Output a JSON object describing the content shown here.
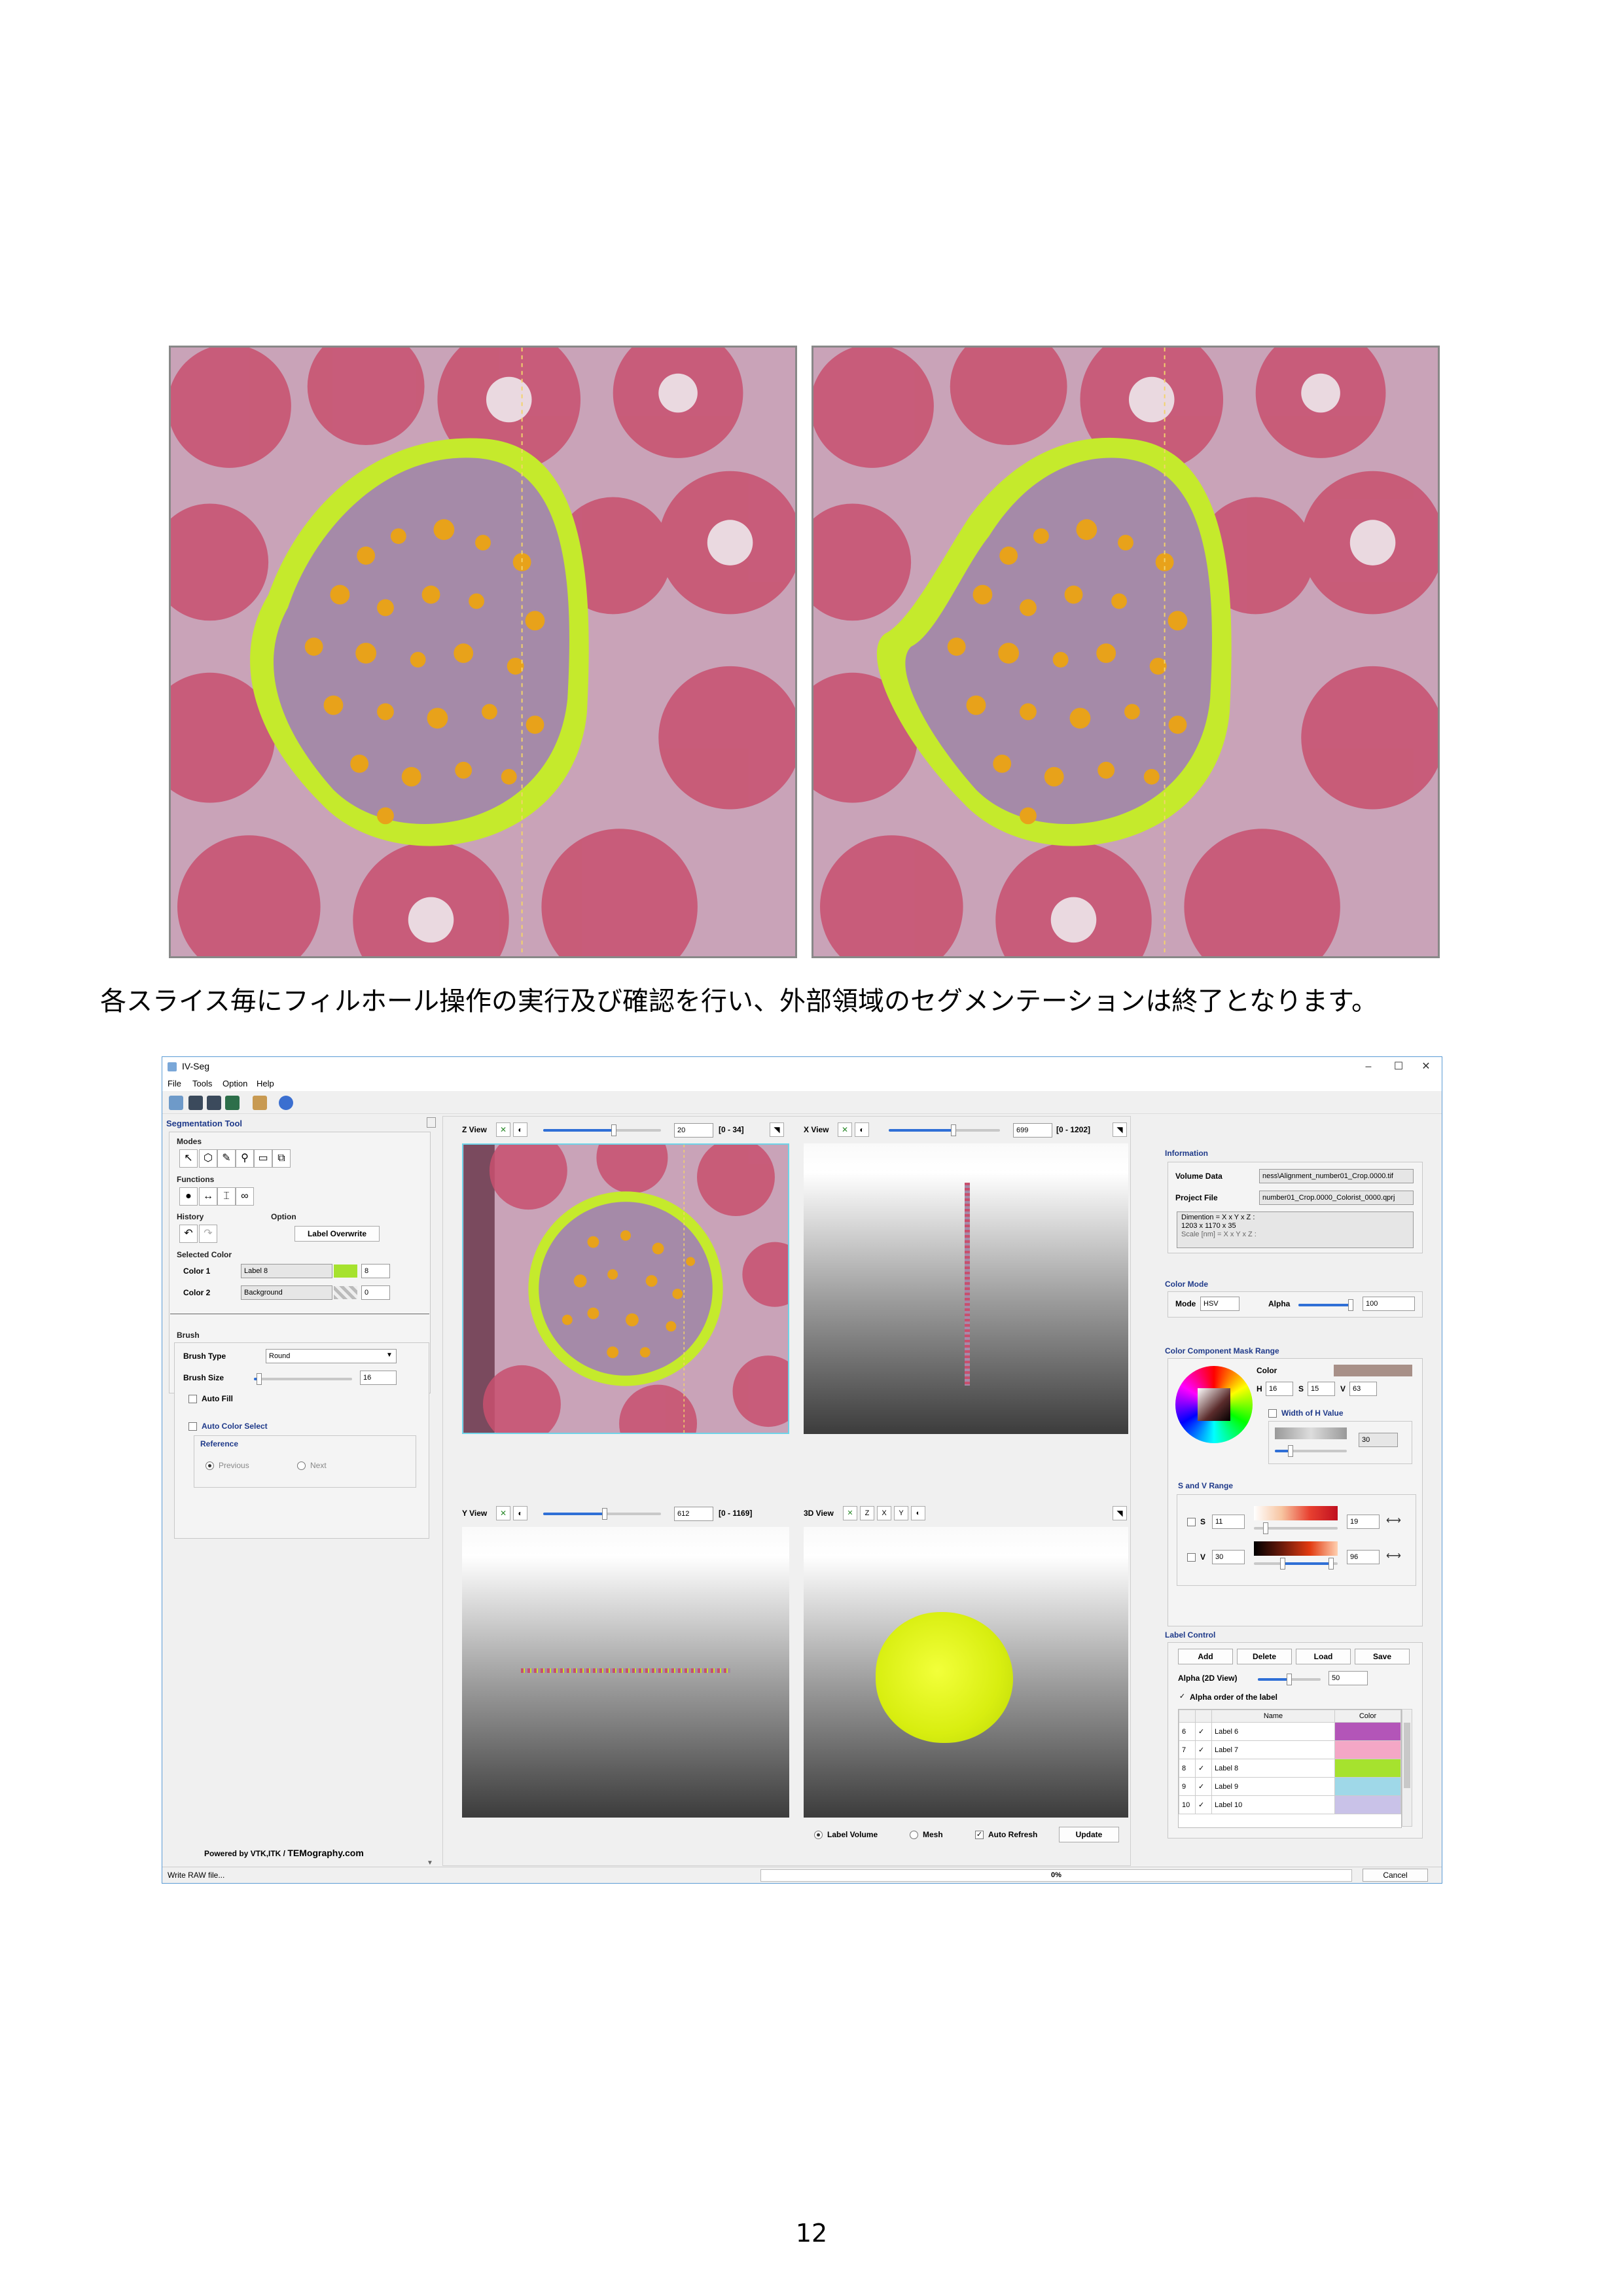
{
  "caption": "各スライス毎にフィルホール操作の実行及び確認を行い、外部領域のセグメンテーションは終了となります。",
  "page_number": "12",
  "window": {
    "title": "IV-Seg",
    "menu": [
      "File",
      "Tools",
      "Option",
      "Help"
    ],
    "controls": {
      "minimize": "–",
      "maximize": "☐",
      "close": "✕"
    }
  },
  "left_panel": {
    "title": "Segmentation Tool",
    "modes_label": "Modes",
    "functions_label": "Functions",
    "history_label": "History",
    "option_label": "Option",
    "label_overwrite": "Label Overwrite",
    "selected_color_label": "Selected Color",
    "color1_label": "Color 1",
    "color1_value": "Label 8",
    "color1_index": "8",
    "color1_swatch": "#a6e22e",
    "color2_label": "Color 2",
    "color2_value": "Background",
    "color2_index": "0",
    "brush_label": "Brush",
    "brush_type_label": "Brush Type",
    "brush_type_value": "Round",
    "brush_size_label": "Brush Size",
    "brush_size_value": "16",
    "brush_size_level": 0.05,
    "auto_fill": "Auto Fill",
    "auto_color_select": "Auto Color Select",
    "reference_label": "Reference",
    "previous": "Previous",
    "next": "Next",
    "powered_by": "Powered by VTK,ITK / ",
    "powered_brand": "TEMography.com"
  },
  "views": {
    "z": {
      "label": "Z View",
      "value": "20",
      "range": "[0 - 34]",
      "level": 0.6
    },
    "x": {
      "label": "X View",
      "value": "699",
      "range": "[0 - 1202]",
      "level": 0.58
    },
    "y": {
      "label": "Y View",
      "value": "612",
      "range": "[0 - 1169]",
      "level": 0.52
    },
    "d3": {
      "label": "3D View"
    },
    "label_volume": "Label Volume",
    "mesh": "Mesh",
    "auto_refresh": "Auto Refresh",
    "update": "Update"
  },
  "right_panel": {
    "information_label": "Information",
    "volume_data_label": "Volume Data",
    "volume_data_value": "ness\\Alignment_number01_Crop.0000.tif",
    "project_file_label": "Project File",
    "project_file_value": "number01_Crop.0000_Colorist_0000.qprj",
    "dimension_line1": "Dimention = X x Y x Z :",
    "dimension_line2": "1203 x 1170 x 35",
    "dimension_line3": "Scale [nm] = X x Y x Z :",
    "color_mode_label": "Color Mode",
    "mode_label": "Mode",
    "mode_value": "HSV",
    "alpha_label": "Alpha",
    "alpha_value": "100",
    "alpha_level": 1.0,
    "mask_range_label": "Color Component Mask Range",
    "color_label": "Color",
    "color_swatch": "#a89088",
    "h_label": "H",
    "h_value": "16",
    "s_label": "S",
    "s_value": "15",
    "v_label": "V",
    "v_value": "63",
    "width_h_label": "Width of H Value",
    "width_h_value": "30",
    "sv_range_label": "S and V Range",
    "s_min": "11",
    "s_max": "19",
    "v_min": "30",
    "v_max": "96",
    "label_control_label": "Label Control",
    "add": "Add",
    "delete": "Delete",
    "load": "Load",
    "save": "Save",
    "alpha2d_label": "Alpha (2D View)",
    "alpha2d_value": "50",
    "alpha2d_level": 0.5,
    "alpha_order_label": "Alpha order of the label",
    "table_name_header": "Name",
    "table_color_header": "Color",
    "labels": [
      {
        "index": "6",
        "name": "Label 6",
        "color": "#b355b8"
      },
      {
        "index": "7",
        "name": "Label 7",
        "color": "#f4a7c6"
      },
      {
        "index": "8",
        "name": "Label 8",
        "color": "#a6e22e"
      },
      {
        "index": "9",
        "name": "Label 9",
        "color": "#9fd8e8"
      },
      {
        "index": "10",
        "name": "Label 10",
        "color": "#c9c2e8"
      }
    ]
  },
  "status": {
    "message": "Write RAW file...",
    "progress_text": "0%",
    "cancel": "Cancel"
  }
}
